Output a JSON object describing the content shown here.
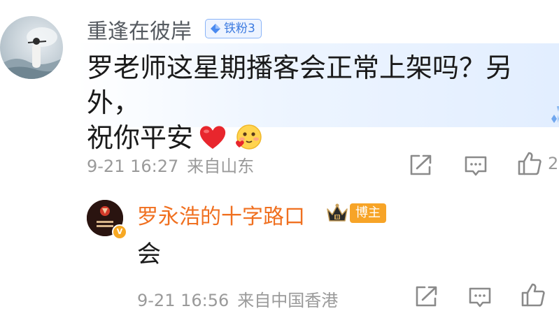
{
  "comment": {
    "username": "重逢在彼岸",
    "fan_badge": "铁粉3",
    "text_line1": "罗老师这星期播客会正常上架吗？另外，",
    "text_line2": "祝你平安",
    "time": "9-21 16:27",
    "location": "来自山东",
    "like_count": "2"
  },
  "reply": {
    "username": "罗永浩的十字路口",
    "owner_badge": "博主",
    "text": "会",
    "time": "9-21 16:56",
    "location": "来自中国香港"
  },
  "icons": {
    "share": "share-icon",
    "comment": "comment-icon",
    "like": "thumbs-up-icon",
    "heart": "red-heart-emoji",
    "emoji": "blushing-face-emoji"
  },
  "colors": {
    "username_gray": "#555a60",
    "owner_name_orange": "#f07020",
    "fan_badge_blue": "#3d7be0",
    "owner_badge_orange": "#f7a427",
    "meta_gray": "#9a9a9a"
  }
}
